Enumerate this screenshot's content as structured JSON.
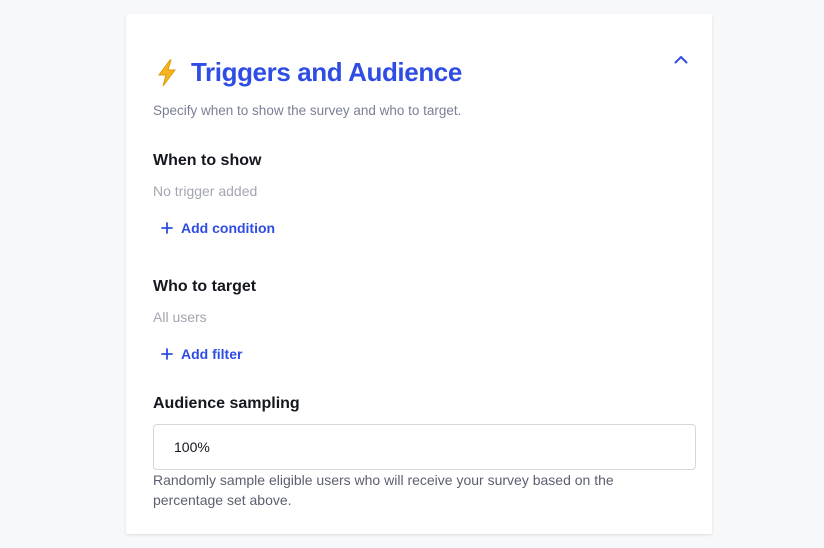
{
  "header": {
    "title": "Triggers and Audience",
    "subtitle": "Specify when to show the survey and who to target.",
    "icon": "lightning-bolt-icon",
    "collapse_icon": "chevron-up-icon",
    "accent_color": "#2f4de4",
    "icon_color": "#f5b521"
  },
  "when_to_show": {
    "title": "When to show",
    "empty_text": "No trigger added",
    "add_label": "Add condition"
  },
  "who_to_target": {
    "title": "Who to target",
    "empty_text": "All users",
    "add_label": "Add filter"
  },
  "audience_sampling": {
    "title": "Audience sampling",
    "value": "100%",
    "help": "Randomly sample eligible users who will receive your survey based on the percentage set above."
  }
}
